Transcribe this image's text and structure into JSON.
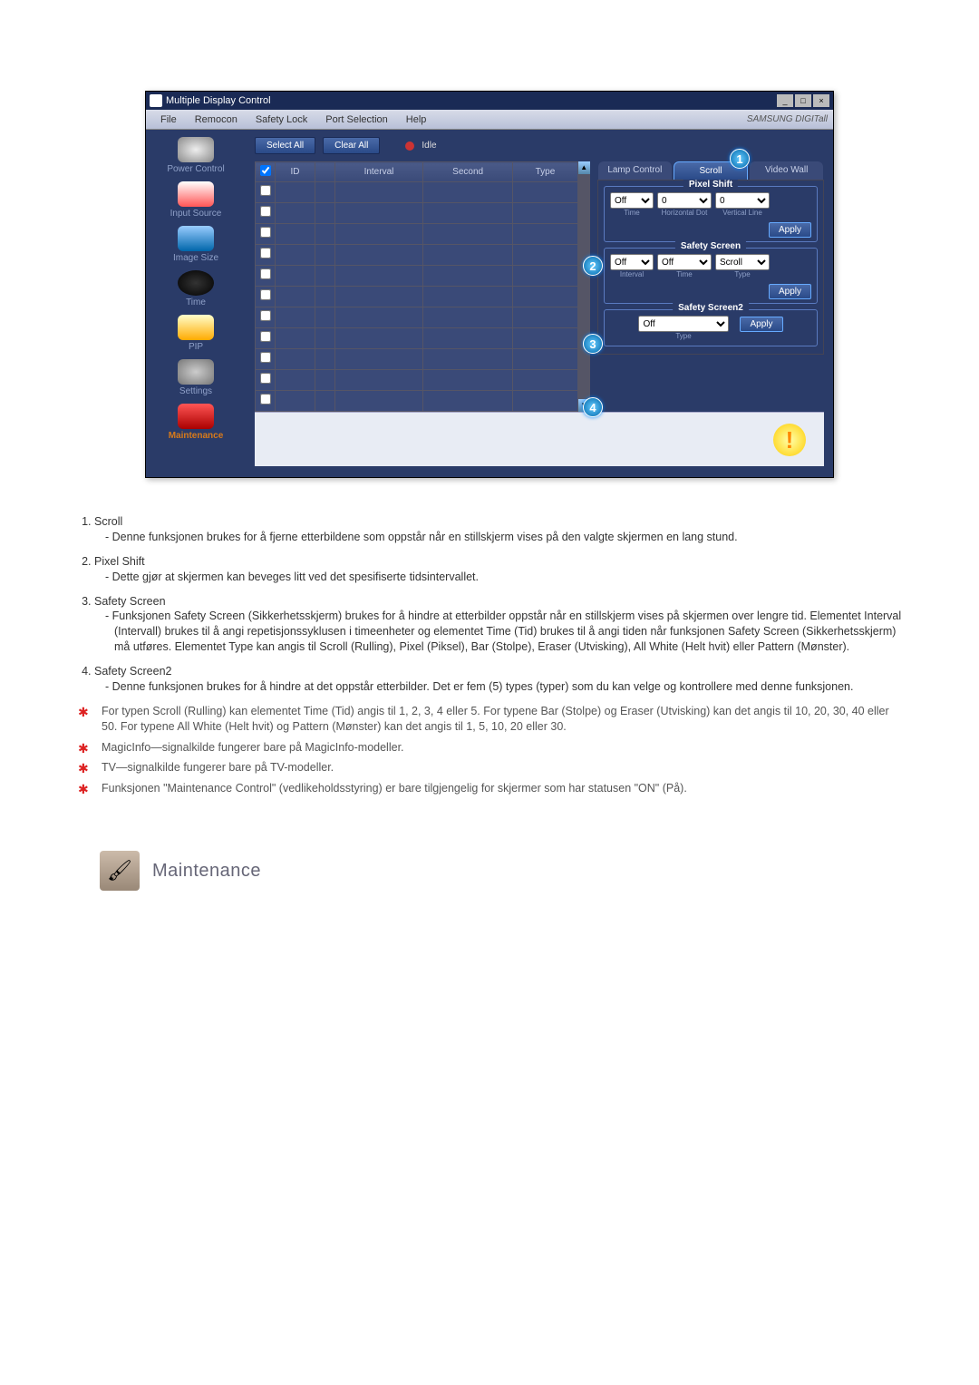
{
  "window": {
    "title": "Multiple Display Control",
    "menu": [
      "File",
      "Remocon",
      "Safety Lock",
      "Port Selection",
      "Help"
    ],
    "brand": "SAMSUNG DIGITall"
  },
  "sidebar": [
    {
      "label": "Power Control"
    },
    {
      "label": "Input Source"
    },
    {
      "label": "Image Size"
    },
    {
      "label": "Time"
    },
    {
      "label": "PIP"
    },
    {
      "label": "Settings"
    },
    {
      "label": "Maintenance",
      "active": true
    }
  ],
  "toolbar": {
    "select_all": "Select All",
    "clear_all": "Clear All",
    "status": "Idle"
  },
  "grid": {
    "columns": [
      "",
      "ID",
      "",
      "Interval",
      "Second",
      "Type"
    ],
    "rows": 11
  },
  "tabs": {
    "items": [
      "Lamp Control",
      "Scroll",
      "Video Wall"
    ],
    "active": 1
  },
  "panels": {
    "pixel_shift": {
      "title": "Pixel Shift",
      "state": "Off",
      "h": "0",
      "v": "0",
      "labels": {
        "time": "Time",
        "h": "Horizontal Dot",
        "v": "Vertical Line"
      },
      "apply": "Apply"
    },
    "safety_screen": {
      "title": "Safety Screen",
      "state": "Off",
      "time_state": "Off",
      "type": "Scroll",
      "labels": {
        "interval": "Interval",
        "time": "Time",
        "type": "Type"
      },
      "apply": "Apply"
    },
    "safety_screen2": {
      "title": "Safety Screen2",
      "state": "Off",
      "labels": {
        "type": "Type"
      },
      "apply": "Apply"
    }
  },
  "callouts": [
    "1",
    "2",
    "3",
    "4"
  ],
  "desc_items": [
    {
      "title": "Scroll",
      "text": "Denne funksjonen brukes for å fjerne etterbildene som oppstår når en stillskjerm vises på den valgte skjermen en lang stund."
    },
    {
      "title": "Pixel Shift",
      "text": "Dette gjør at skjermen kan beveges litt ved det spesifiserte tidsintervallet."
    },
    {
      "title": "Safety Screen",
      "text": "Funksjonen Safety Screen (Sikkerhetsskjerm) brukes for å hindre at etterbilder oppstår når en stillskjerm vises på skjermen over lengre tid.  Elementet Interval (Intervall) brukes til å angi repetisjonssyklusen i timeenheter og elementet Time (Tid) brukes til å angi tiden når funksjonen Safety Screen (Sikkerhetsskjerm) må utføres. Elementet Type kan angis til Scroll (Rulling), Pixel (Piksel), Bar (Stolpe), Eraser (Utvisking), All White (Helt hvit) eller Pattern (Mønster)."
    },
    {
      "title": "Safety Screen2",
      "text": "Denne funksjonen brukes for å hindre at det oppstår etterbilder. Det er fem (5) types (typer) som du kan velge og kontrollere med denne funksjonen."
    }
  ],
  "notes": [
    "For typen Scroll (Rulling) kan elementet Time (Tid) angis til 1, 2, 3, 4 eller 5. For typene Bar (Stolpe) og Eraser (Utvisking) kan det angis til 10, 20, 30, 40 eller 50. For typene All White (Helt hvit) og Pattern (Mønster) kan det angis til 1, 5, 10, 20 eller 30.",
    "MagicInfo—signalkilde fungerer bare på MagicInfo-modeller.",
    "TV—signalkilde fungerer bare på TV-modeller.",
    "Funksjonen \"Maintenance Control\" (vedlikeholdsstyring) er bare tilgjengelig for skjermer som har statusen \"ON\" (På)."
  ],
  "section_heading": "Maintenance"
}
